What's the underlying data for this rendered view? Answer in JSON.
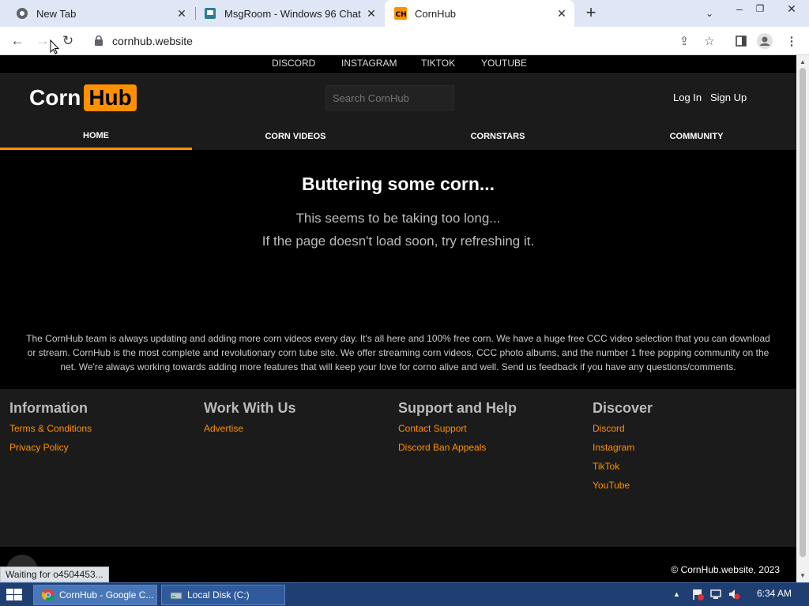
{
  "browser": {
    "tabs": [
      {
        "title": "New Tab",
        "active": false
      },
      {
        "title": "MsgRoom - Windows 96 Chat",
        "active": false
      },
      {
        "title": "CornHub",
        "active": true
      }
    ],
    "url": "cornhub.website",
    "status_text": "Waiting for o4504453..."
  },
  "site": {
    "social_links": [
      "DISCORD",
      "INSTAGRAM",
      "TIKTOK",
      "YOUTUBE"
    ],
    "logo": {
      "part1": "Corn",
      "part2": "Hub"
    },
    "search_placeholder": "Search CornHub",
    "login": "Log In",
    "signup": "Sign Up",
    "nav": [
      "HOME",
      "CORN VIDEOS",
      "CORNSTARS",
      "COMMUNITY"
    ],
    "active_nav": "HOME",
    "loading": {
      "title": "Buttering some corn...",
      "line1": "This seems to be taking too long...",
      "line2": "If the page doesn't load soon, try refreshing it."
    },
    "about": "The CornHub team is always updating and adding more corn videos every day. It's all here and 100% free corn. We have a huge free CCC video selection that you can download or stream. CornHub is the most complete and revolutionary corn tube site. We offer streaming corn videos, CCC photo albums, and the number 1 free popping community on the net. We're always working towards adding more features that will keep your love for corno alive and well. Send us feedback if you have any questions/comments.",
    "footer": {
      "information": {
        "title": "Information",
        "links": [
          "Terms & Conditions",
          "Privacy Policy"
        ]
      },
      "work": {
        "title": "Work With Us",
        "links": [
          "Advertise"
        ]
      },
      "support": {
        "title": "Support and Help",
        "links": [
          "Contact Support",
          "Discord Ban Appeals"
        ]
      },
      "discover": {
        "title": "Discover",
        "links": [
          "Discord",
          "Instagram",
          "TikTok",
          "YouTube"
        ]
      }
    },
    "copyright": "© CornHub.website, 2023",
    "accent_color": "#ff9000"
  },
  "taskbar": {
    "items": [
      {
        "label": "CornHub - Google C...",
        "active": true
      },
      {
        "label": "Local Disk (C:)",
        "active": false
      }
    ],
    "clock": "6:34 AM"
  }
}
